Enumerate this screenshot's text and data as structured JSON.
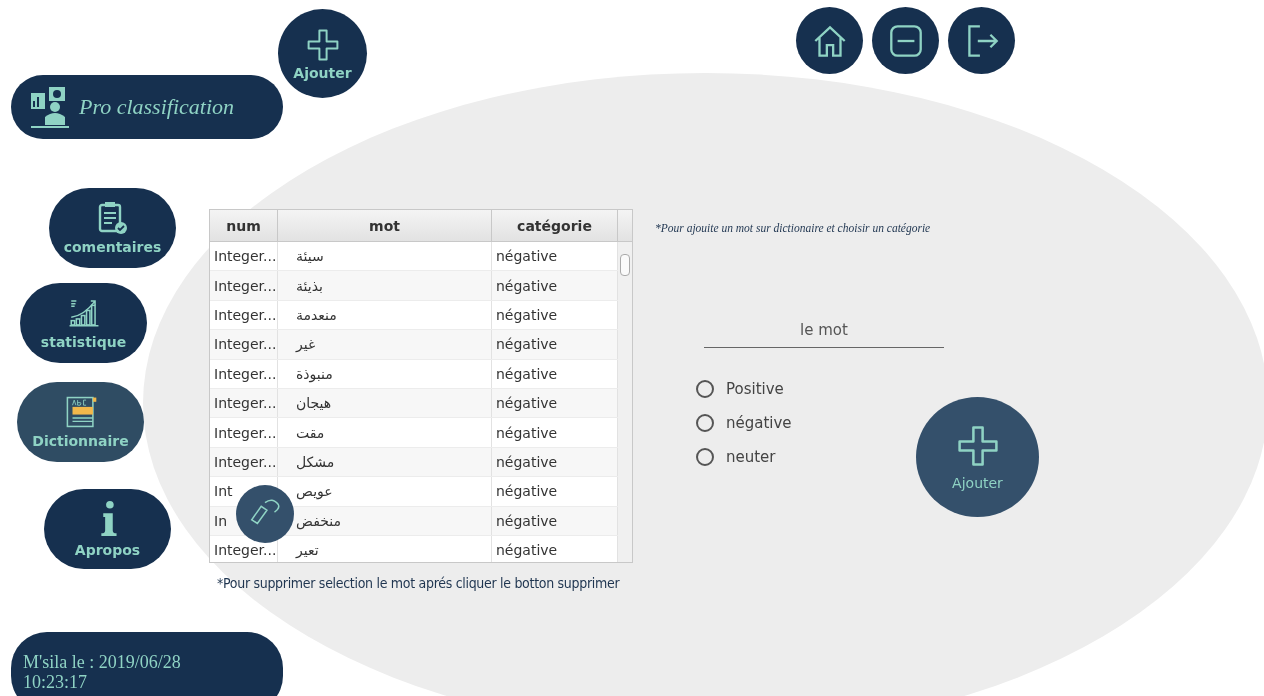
{
  "brand": {
    "title": "Pro classification"
  },
  "top_add_button": {
    "label": "Ajouter"
  },
  "window_controls": [
    {
      "kind": "home"
    },
    {
      "kind": "minimize"
    },
    {
      "kind": "exit"
    }
  ],
  "nav": [
    {
      "kind": "comments",
      "label": "comentaires",
      "selected": false
    },
    {
      "kind": "stats",
      "label": "statistique",
      "selected": false
    },
    {
      "kind": "dictionary",
      "label": "Dictionnaire",
      "selected": true
    },
    {
      "kind": "info",
      "label": "Apropos",
      "selected": false
    }
  ],
  "table": {
    "columns": [
      "num",
      "mot",
      "catégorie"
    ],
    "rows": [
      {
        "num": "Integer...",
        "mot": "سيئة",
        "categorie": "négative"
      },
      {
        "num": "Integer...",
        "mot": "بذيئة",
        "categorie": "négative"
      },
      {
        "num": "Integer...",
        "mot": "منعدمة",
        "categorie": "négative"
      },
      {
        "num": "Integer...",
        "mot": "غير",
        "categorie": "négative"
      },
      {
        "num": "Integer...",
        "mot": "منبوذة",
        "categorie": "négative"
      },
      {
        "num": "Integer...",
        "mot": "هيجان",
        "categorie": "négative"
      },
      {
        "num": "Integer...",
        "mot": "مقت",
        "categorie": "négative"
      },
      {
        "num": "Integer...",
        "mot": "مشكل",
        "categorie": "négative"
      },
      {
        "num": "Int",
        "mot": "عويص",
        "categorie": "négative"
      },
      {
        "num": "In",
        "mot": "منخفض",
        "categorie": "négative"
      },
      {
        "num": "Integer...",
        "mot": "تعير",
        "categorie": "négative"
      }
    ]
  },
  "delete_hint": "*Pour supprimer selection le mot aprés  cliquer le botton supprimer",
  "add_hint": "*Pour ajouite un mot sur dictionaire  et choisir un  catégorie",
  "word_field": {
    "placeholder": "le mot"
  },
  "categories": [
    {
      "label": "Positive",
      "selected": false
    },
    {
      "label": "négative",
      "selected": false
    },
    {
      "label": "neuter",
      "selected": false
    }
  ],
  "add_button": {
    "label": "Ajouter"
  },
  "date_badge": {
    "line1": "M'sila le : 2019/06/28",
    "line2": "10:23:17"
  }
}
